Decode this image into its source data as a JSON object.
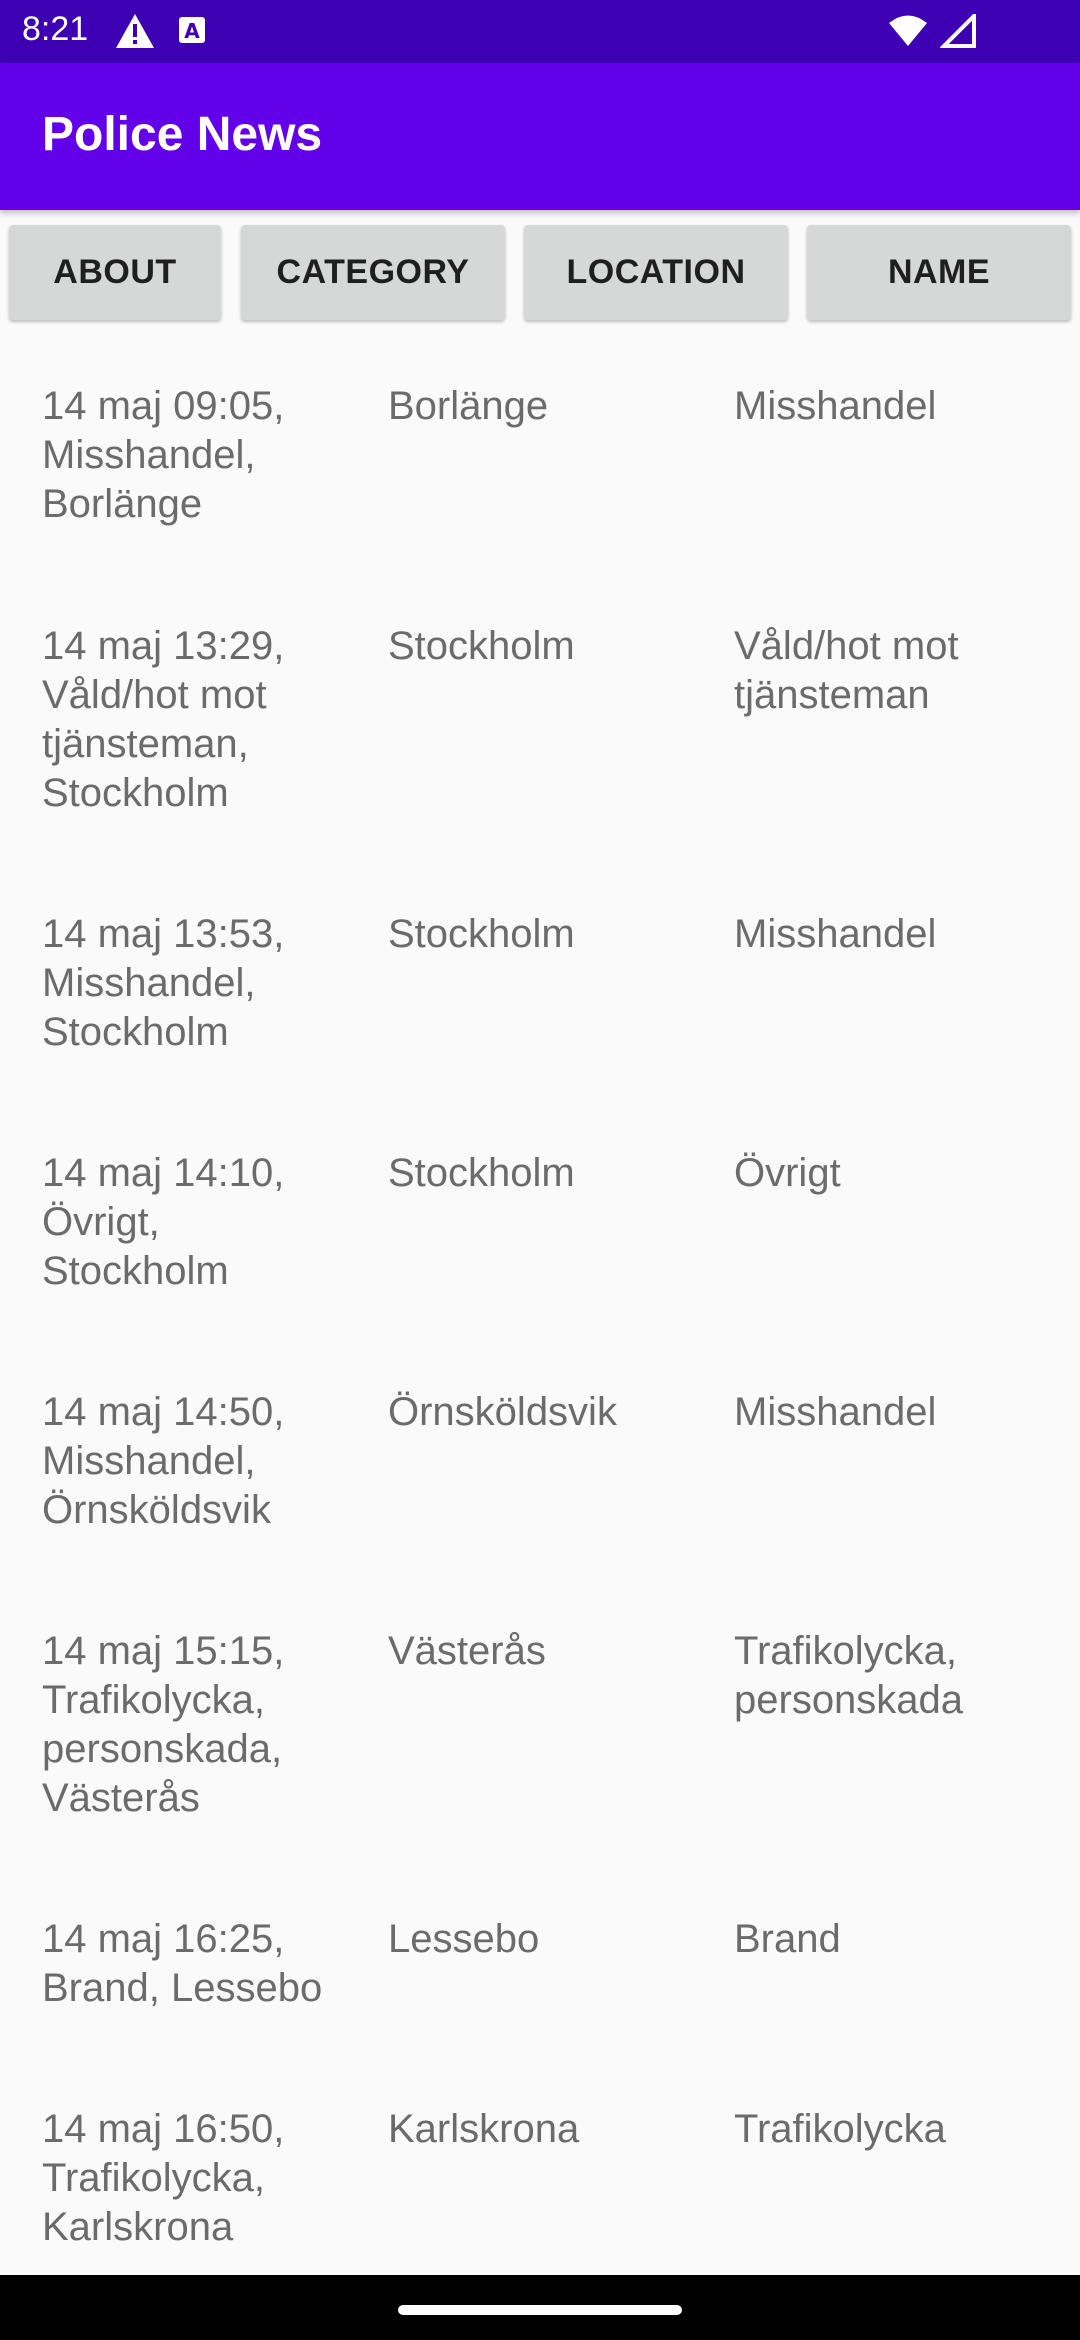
{
  "status_bar": {
    "time": "8:21"
  },
  "app_bar": {
    "title": "Police News"
  },
  "buttons": {
    "about": "ABOUT",
    "category": "CATEGORY",
    "location": "LOCATION",
    "name": "NAME"
  },
  "events": [
    {
      "title": "14 maj 09:05, Misshandel, Borlänge",
      "location": "Borlänge",
      "category": "Misshandel"
    },
    {
      "title": "14 maj 13:29, Våld/hot mot tjänsteman, Stockholm",
      "location": "Stockholm",
      "category": "Våld/hot mot tjänsteman"
    },
    {
      "title": "14 maj 13:53, Misshandel, Stockholm",
      "location": "Stockholm",
      "category": "Misshandel"
    },
    {
      "title": "14 maj 14:10, Övrigt, Stockholm",
      "location": "Stockholm",
      "category": "Övrigt"
    },
    {
      "title": "14 maj 14:50, Misshandel, Örnsköldsvik",
      "location": "Örnsköldsvik",
      "category": "Misshandel"
    },
    {
      "title": "14 maj 15:15, Trafikolycka, personskada, Västerås",
      "location": "Västerås",
      "category": "Trafikolycka, personskada"
    },
    {
      "title": "14 maj 16:25, Brand, Lessebo",
      "location": "Lessebo",
      "category": "Brand"
    },
    {
      "title": "14 maj 16:50, Trafikolycka, Karlskrona",
      "location": "Karlskrona",
      "category": "Trafikolycka"
    }
  ],
  "icons": {
    "status_left": [
      "alert-icon",
      "text-a-icon"
    ],
    "status_right": [
      "wifi-icon",
      "signal-icon"
    ]
  },
  "colors": {
    "status_bar": "#3d00b3",
    "app_bar": "#6200ea",
    "button_bg": "#d6d7d7",
    "list_text": "#6b6b6b",
    "background": "#fafafa"
  }
}
